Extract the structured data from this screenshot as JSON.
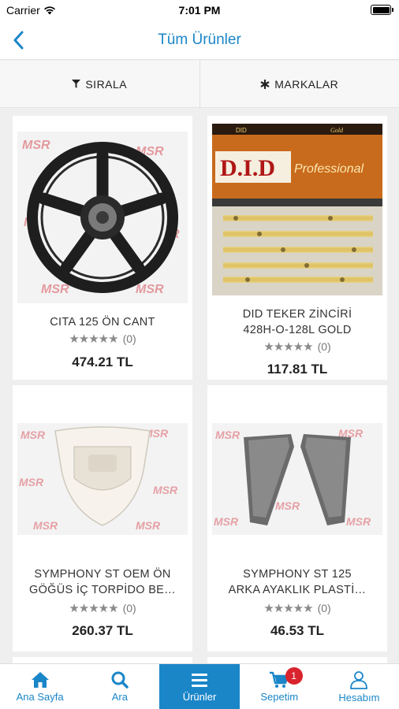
{
  "status_bar": {
    "carrier": "Carrier",
    "time": "7:01 PM"
  },
  "nav": {
    "title": "Tüm Ürünler"
  },
  "filters": {
    "sort_label": "SIRALA",
    "brands_label": "MARKALAR"
  },
  "products": [
    {
      "name_line1": "CITA 125 ÖN CANT",
      "name_line2": "",
      "rating_count": "(0)",
      "price": "474.21 TL",
      "rating": 0,
      "image": "wheel"
    },
    {
      "name_line1": "DID TEKER ZİNCİRİ",
      "name_line2": "428H-O-128L GOLD",
      "rating_count": "(0)",
      "price": "117.81 TL",
      "rating": 0,
      "image": "chain"
    },
    {
      "name_line1": "SYMPHONY ST OEM ÖN",
      "name_line2": "GÖĞÜS İÇ TORPİDO BE…",
      "rating_count": "(0)",
      "price": "260.37 TL",
      "rating": 0,
      "image": "fairing"
    },
    {
      "name_line1": "SYMPHONY ST 125",
      "name_line2": "ARKA AYAKLIK PLASTİ…",
      "rating_count": "(0)",
      "price": "46.53 TL",
      "rating": 0,
      "image": "footrest-panels"
    }
  ],
  "tabs": [
    {
      "label": "Ana Sayfa",
      "icon": "home-icon"
    },
    {
      "label": "Ara",
      "icon": "search-icon"
    },
    {
      "label": "Ürünler",
      "icon": "menu-icon",
      "active": true
    },
    {
      "label": "Sepetim",
      "icon": "cart-icon",
      "badge": "1"
    },
    {
      "label": "Hesabım",
      "icon": "user-icon"
    }
  ],
  "colors": {
    "accent": "#1a86c8",
    "badge": "#d9232d",
    "star": "#8a8a8a"
  }
}
